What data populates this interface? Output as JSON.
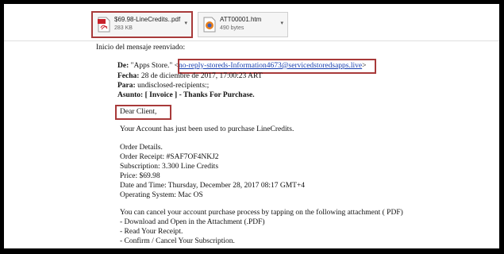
{
  "attachments": [
    {
      "name": "$69.98-LineCredits..pdf",
      "size": "283 KB"
    },
    {
      "name": "ATT00001.htm",
      "size": "490 bytes"
    }
  ],
  "forward_intro": "Inicio del mensaje reenviado:",
  "header": {
    "from_label": "De:",
    "from_name": "\"Apps Store.\"",
    "from_open": "<",
    "from_email": "no-reply-storeds-Information4673@servicedstoredsapps.live",
    "from_close": ">",
    "date_label": "Fecha:",
    "date_value": "28 de diciembre de 2017, 17:00:23 ART",
    "to_label": "Para:",
    "to_value": "undisclosed-recipients:;",
    "subject_label": "Asunto:",
    "subject_value": "[ Invoice ] - Thanks For Purchase."
  },
  "body": {
    "greeting": "Dear Client,",
    "line1": "Your Account has just been used to purchase LineCredits.",
    "order_title": "Order Details.",
    "order_receipt": "Order Receipt: #SAF7OF4NKJ2",
    "subscription": "Subscription: 3.300 Line Credits",
    "price": "Price: $69.98",
    "datetime": "Date and Time: Thursday, December 28, 2017 08:17 GMT+4",
    "os": "Operating System: Mac OS",
    "cancel_line": "You can cancel your account purchase process by tapping on the following attachment ( PDF)",
    "step1": "- Download and Open in the Attachment (.PDF)",
    "step2": "- Read Your Receipt.",
    "step3": "- Confirm / Cancel Your Subscription."
  },
  "colors": {
    "highlight_box": "#a83a3a",
    "link": "#1a3fb0",
    "pdf_icon": "#c8202a"
  }
}
